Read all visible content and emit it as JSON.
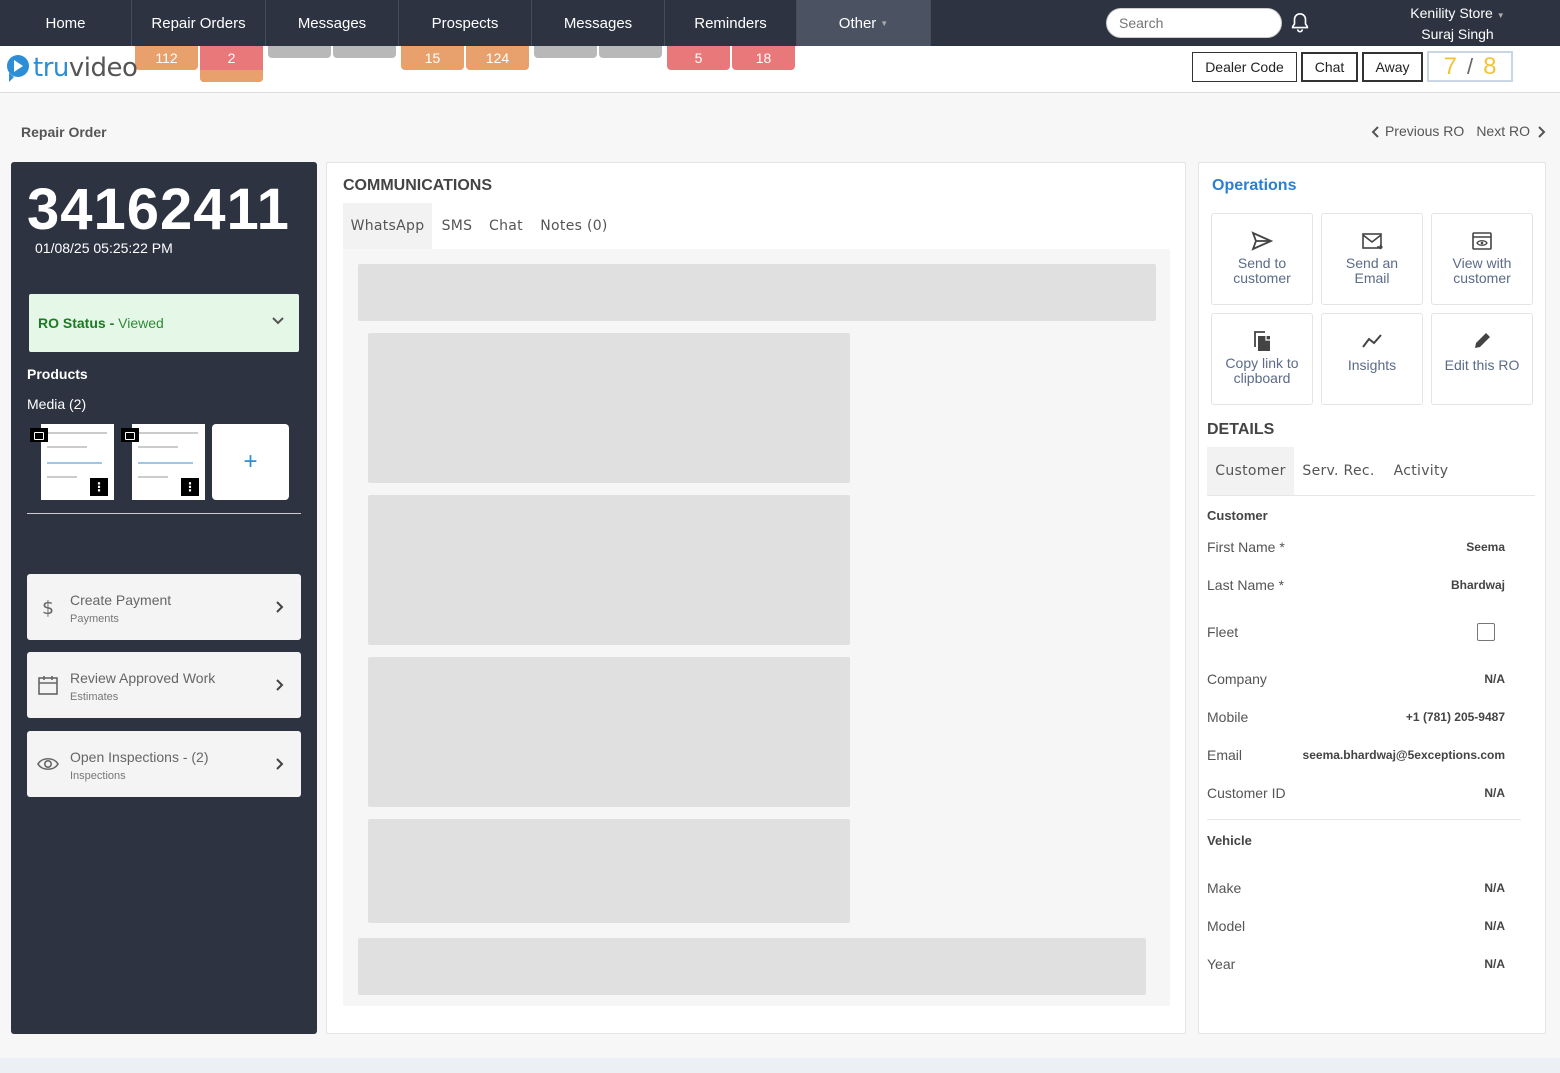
{
  "nav": {
    "tabs": [
      "Home",
      "Repair Orders",
      "Messages",
      "Prospects",
      "Messages",
      "Reminders",
      "Other"
    ],
    "search_placeholder": "Search",
    "store_name": "Kenility Store",
    "user_name": "Suraj Singh"
  },
  "badges": [
    "112",
    "2",
    "15",
    "124",
    "5",
    "18"
  ],
  "logo": {
    "part1": "tru",
    "part2": "video"
  },
  "top_buttons": {
    "dealer_code": "Dealer Code",
    "chat": "Chat",
    "away": "Away"
  },
  "counter": {
    "current": "7",
    "total": "8"
  },
  "breadcrumb": "Repair Order",
  "ro_nav": {
    "previous": "Previous RO",
    "next": "Next RO"
  },
  "left": {
    "ro_number": "34162411",
    "ro_date": "01/08/25 05:25:22 PM",
    "status_label": "RO Status -",
    "status_value": "Viewed",
    "products_heading": "Products",
    "media_heading": "Media (2)",
    "add_media": "+",
    "actions": [
      {
        "title": "Create Payment",
        "subtitle": "Payments",
        "icon": "dollar-icon"
      },
      {
        "title": "Review Approved Work",
        "subtitle": "Estimates",
        "icon": "calendar-icon"
      },
      {
        "title": "Open Inspections - (2)",
        "subtitle": "Inspections",
        "icon": "eye-icon"
      }
    ]
  },
  "communications": {
    "heading": "COMMUNICATIONS",
    "tabs": [
      "WhatsApp",
      "SMS",
      "Chat",
      "Notes (0)"
    ]
  },
  "operations": {
    "heading": "Operations",
    "buttons": [
      {
        "line1": "Send to",
        "line2": "customer",
        "icon": "send-icon"
      },
      {
        "line1": "Send an",
        "line2": "Email",
        "icon": "email-icon"
      },
      {
        "line1": "View with",
        "line2": "customer",
        "icon": "view-icon"
      },
      {
        "line1": "Copy link to",
        "line2": "clipboard",
        "icon": "copy-icon"
      },
      {
        "line1": "Insights",
        "line2": "",
        "icon": "insights-icon"
      },
      {
        "line1": "Edit this RO",
        "line2": "",
        "icon": "edit-icon"
      }
    ]
  },
  "details": {
    "heading": "DETAILS",
    "tabs": [
      "Customer",
      "Serv. Rec.",
      "Activity"
    ],
    "customer_heading": "Customer",
    "customer_fields": [
      {
        "label": "First Name *",
        "value": "Seema"
      },
      {
        "label": "Last Name *",
        "value": "Bhardwaj"
      },
      {
        "label": "Fleet",
        "value": ""
      },
      {
        "label": "Company",
        "value": "N/A"
      },
      {
        "label": "Mobile",
        "value": "+1 (781) 205-9487"
      },
      {
        "label": "Email",
        "value": "seema.bhardwaj@5exceptions.com"
      },
      {
        "label": "Customer ID",
        "value": "N/A"
      }
    ],
    "vehicle_heading": "Vehicle",
    "vehicle_fields": [
      {
        "label": "Make",
        "value": "N/A"
      },
      {
        "label": "Model",
        "value": "N/A"
      },
      {
        "label": "Year",
        "value": "N/A"
      }
    ]
  },
  "colors": {
    "nav_bg": "#2d3340",
    "accent": "#2b8ed6",
    "badge_orange": "#e8a06c",
    "badge_red": "#e8787a",
    "status_bg": "#e5f7e7",
    "counter": "#f2c33a"
  }
}
